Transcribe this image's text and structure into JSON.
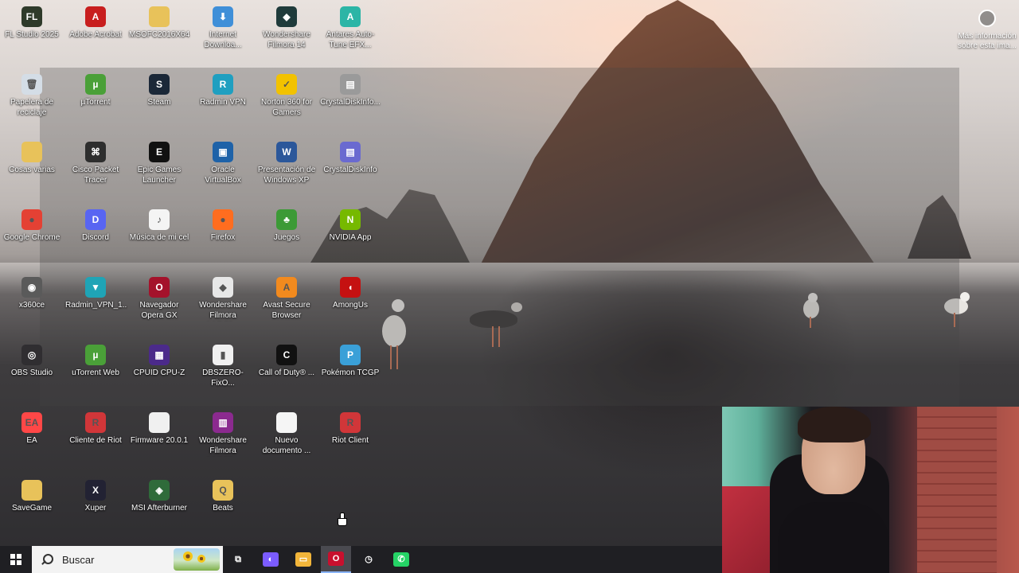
{
  "desktop": {
    "icons": [
      {
        "label": "FL Studio 2025",
        "icon": "fl-studio-icon",
        "color": "#2e3a2a",
        "glyph": "FL"
      },
      {
        "label": "Adobe Acrobat",
        "icon": "pdf-icon",
        "color": "#c81e1e",
        "glyph": "A"
      },
      {
        "label": "MSOFC2016X64",
        "icon": "folder-icon",
        "color": "#e8c25a",
        "glyph": ""
      },
      {
        "label": "Internet Downloa...",
        "icon": "globe-download-icon",
        "color": "#3f8fd8",
        "glyph": "⬇"
      },
      {
        "label": "Wondershare Filmora 14",
        "icon": "filmora-icon",
        "color": "#1f3b3b",
        "glyph": "◆"
      },
      {
        "label": "Antares Auto-Tune EFX...",
        "icon": "antares-icon",
        "color": "#2cb5a6",
        "glyph": "A"
      },
      {
        "label": "Papelera de reciclaje",
        "icon": "recycle-bin-icon",
        "color": "#d4dde6",
        "glyph": "🗑"
      },
      {
        "label": "µTorrent",
        "icon": "utorrent-icon",
        "color": "#4aa038",
        "glyph": "µ"
      },
      {
        "label": "Steam",
        "icon": "steam-icon",
        "color": "#1b2838",
        "glyph": "S"
      },
      {
        "label": "Radmin VPN",
        "icon": "radmin-vpn-icon",
        "color": "#1f9fc0",
        "glyph": "R"
      },
      {
        "label": "Norton 360 for Gamers",
        "icon": "norton-icon",
        "color": "#f2c200",
        "glyph": "✓"
      },
      {
        "label": "CrystalDiskInfo...",
        "icon": "crystaldisk-icon",
        "color": "#9a9a9a",
        "glyph": "▤"
      },
      {
        "label": "Cosas varias",
        "icon": "folder-icon",
        "color": "#e8c25a",
        "glyph": ""
      },
      {
        "label": "Cisco Packet Tracer",
        "icon": "cisco-icon",
        "color": "#2e2e2e",
        "glyph": "⌘"
      },
      {
        "label": "Epic Games Launcher",
        "icon": "epic-games-icon",
        "color": "#111111",
        "glyph": "E"
      },
      {
        "label": "Oracle VirtualBox",
        "icon": "virtualbox-icon",
        "color": "#1e62a8",
        "glyph": "▣"
      },
      {
        "label": "Presentación de Windows XP",
        "icon": "word-doc-icon",
        "color": "#2b579a",
        "glyph": "W"
      },
      {
        "label": "CrystalDiskInfo",
        "icon": "crystaldisk-icon",
        "color": "#6a6ad0",
        "glyph": "▤"
      },
      {
        "label": "Google Chrome",
        "icon": "chrome-icon",
        "color": "#e44134",
        "glyph": "●"
      },
      {
        "label": "Discord",
        "icon": "discord-icon",
        "color": "#5865f2",
        "glyph": "D"
      },
      {
        "label": "Música de mi cel",
        "icon": "folder-music-icon",
        "color": "#f4f4f4",
        "glyph": "♪"
      },
      {
        "label": "Firefox",
        "icon": "firefox-icon",
        "color": "#ff6d1f",
        "glyph": "●"
      },
      {
        "label": "Juegos",
        "icon": "tree-folder-icon",
        "color": "#3c9a36",
        "glyph": "♣"
      },
      {
        "label": "NVIDIA App",
        "icon": "nvidia-icon",
        "color": "#76b900",
        "glyph": "N"
      },
      {
        "label": "x360ce",
        "icon": "gamepad-icon",
        "color": "#5a5a5a",
        "glyph": "◉"
      },
      {
        "label": "Radmin_VPN_1...",
        "icon": "radmin-installer-icon",
        "color": "#1fa4b6",
        "glyph": "▼"
      },
      {
        "label": "Navegador Opera GX",
        "icon": "opera-gx-icon",
        "color": "#a4122b",
        "glyph": "O"
      },
      {
        "label": "Wondershare Filmora 14.5.20...",
        "icon": "installer-icon",
        "color": "#e7e7e7",
        "glyph": "◆"
      },
      {
        "label": "Avast Secure Browser",
        "icon": "avast-browser-icon",
        "color": "#f28a1e",
        "glyph": "A"
      },
      {
        "label": "AmongUs",
        "icon": "among-us-icon",
        "color": "#c51111",
        "glyph": "◖"
      },
      {
        "label": "OBS Studio",
        "icon": "obs-icon",
        "color": "#302e31",
        "glyph": "◎"
      },
      {
        "label": "uTorrent Web",
        "icon": "utorrent-web-icon",
        "color": "#4aa038",
        "glyph": "µ"
      },
      {
        "label": "CPUID CPU-Z",
        "icon": "cpuz-icon",
        "color": "#4b2a8a",
        "glyph": "▦"
      },
      {
        "label": "DBSZERO-FixO...",
        "icon": "file-icon",
        "color": "#f0f0f0",
        "glyph": "▮"
      },
      {
        "label": "Call of Duty® ...",
        "icon": "call-of-duty-icon",
        "color": "#111111",
        "glyph": "C"
      },
      {
        "label": "Pokémon TCGP",
        "icon": "pokemon-tcgp-icon",
        "color": "#3aa0d8",
        "glyph": "P"
      },
      {
        "label": "EA",
        "icon": "ea-icon",
        "color": "#ff4747",
        "glyph": "EA"
      },
      {
        "label": "Cliente de Riot",
        "icon": "riot-client-icon",
        "color": "#d13639",
        "glyph": "R"
      },
      {
        "label": "Firmware 20.0.1",
        "icon": "file-blank-icon",
        "color": "#f0f0f0",
        "glyph": ""
      },
      {
        "label": "Wondershare Filmora 14.5.20...",
        "icon": "winrar-icon",
        "color": "#8b2a8f",
        "glyph": "▥"
      },
      {
        "label": "Nuevo documento ...",
        "icon": "text-doc-icon",
        "color": "#f5f5f5",
        "glyph": ""
      },
      {
        "label": "Riot Client",
        "icon": "riot-client-icon",
        "color": "#d13639",
        "glyph": "R"
      },
      {
        "label": "SaveGame",
        "icon": "folder-icon",
        "color": "#e8c25a",
        "glyph": ""
      },
      {
        "label": "Xuper",
        "icon": "xuper-icon",
        "color": "#222233",
        "glyph": "X"
      },
      {
        "label": "MSI Afterburner",
        "icon": "msi-afterburner-icon",
        "color": "#2f6b3a",
        "glyph": "◈"
      },
      {
        "label": "Beats",
        "icon": "folder-icon",
        "color": "#e8c25a",
        "glyph": "Q"
      }
    ],
    "info_button": {
      "label": "Más información sobre esta ima..."
    }
  },
  "taskbar": {
    "search_placeholder": "Buscar",
    "apps": [
      {
        "name": "task-view-icon",
        "glyph": "⧉",
        "color": "#1f1f23"
      },
      {
        "name": "copilot-icon",
        "glyph": "◐",
        "color": "#7b5cff"
      },
      {
        "name": "file-explorer-icon",
        "glyph": "▭",
        "color": "#f2b53a"
      },
      {
        "name": "opera-gx-icon",
        "glyph": "O",
        "color": "#c8102e"
      },
      {
        "name": "clock-app-icon",
        "glyph": "◷",
        "color": "#1f1f23"
      },
      {
        "name": "whatsapp-icon",
        "glyph": "✆",
        "color": "#25d366"
      }
    ]
  }
}
